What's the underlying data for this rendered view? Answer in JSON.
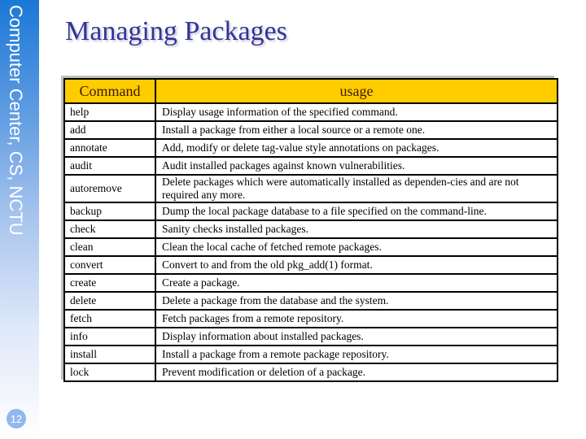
{
  "sidebar": {
    "label": "Computer Center, CS, NCTU",
    "page_number": "12"
  },
  "title": "Managing Packages",
  "table": {
    "headers": [
      "Command",
      "usage"
    ],
    "rows": [
      {
        "command": "help",
        "usage": "Display usage information of the specified command."
      },
      {
        "command": "add",
        "usage": "Install a package from either a local source or a remote one."
      },
      {
        "command": "annotate",
        "usage": "Add, modify or delete tag-value style annotations on packages."
      },
      {
        "command": "audit",
        "usage": "Audit installed packages against known vulnerabilities."
      },
      {
        "command": "autoremove",
        "usage": "Delete packages which were automatically installed as dependen-cies and are not required any more."
      },
      {
        "command": "backup",
        "usage": "Dump the local package database to a file specified on the command-line."
      },
      {
        "command": "check",
        "usage": "Sanity checks installed packages."
      },
      {
        "command": "clean",
        "usage": "Clean the local cache of fetched remote packages."
      },
      {
        "command": "convert",
        "usage": "Convert to and from the old pkg_add(1) format."
      },
      {
        "command": "create",
        "usage": "Create a package."
      },
      {
        "command": "delete",
        "usage": "Delete a package from the database and the system."
      },
      {
        "command": "fetch",
        "usage": "Fetch packages from a remote repository."
      },
      {
        "command": "info",
        "usage": "Display information about installed packages."
      },
      {
        "command": "install",
        "usage": "Install a package from a remote package repository."
      },
      {
        "command": "lock",
        "usage": "Prevent modification or deletion of a package."
      }
    ]
  },
  "colors": {
    "header_bg": "#ffcc00",
    "title": "#333399",
    "sidebar_top": "#1a78d6",
    "badge": "#8fb8ee"
  }
}
